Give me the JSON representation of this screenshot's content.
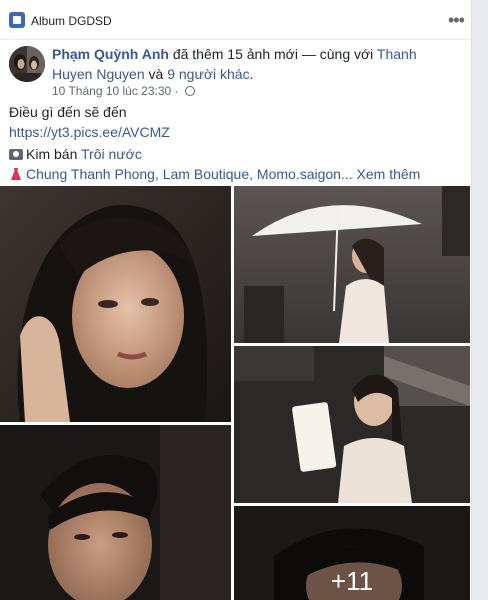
{
  "header": {
    "album_title": "Album DGDSD",
    "menu_icon": "three-dots-icon"
  },
  "post": {
    "author": "Phạm Quỳnh Anh",
    "action": " đã thêm 15 ảnh mới — cùng với ",
    "tagged_user": "Thanh Huyen Nguyen",
    "and_text": " và ",
    "others": "9 người khác",
    "period": ".",
    "timestamp": "10 Tháng 10 lúc 23:30",
    "dot": " · ",
    "privacy_icon": "globe-icon",
    "caption": "Điều gì đến sẽ đến",
    "url": "https://yt3.pics.ee/AVCMZ",
    "song_prefix": "Kim bán ",
    "song_link": "Trôi nước",
    "credits": "Chung Thanh Phong, Lam Boutique, Momo.saigon...",
    "see_more": "Xem thêm"
  },
  "photos": {
    "more_count": "+11"
  },
  "colors": {
    "link": "#365899",
    "meta": "#616770",
    "background": "#e9ebee"
  }
}
